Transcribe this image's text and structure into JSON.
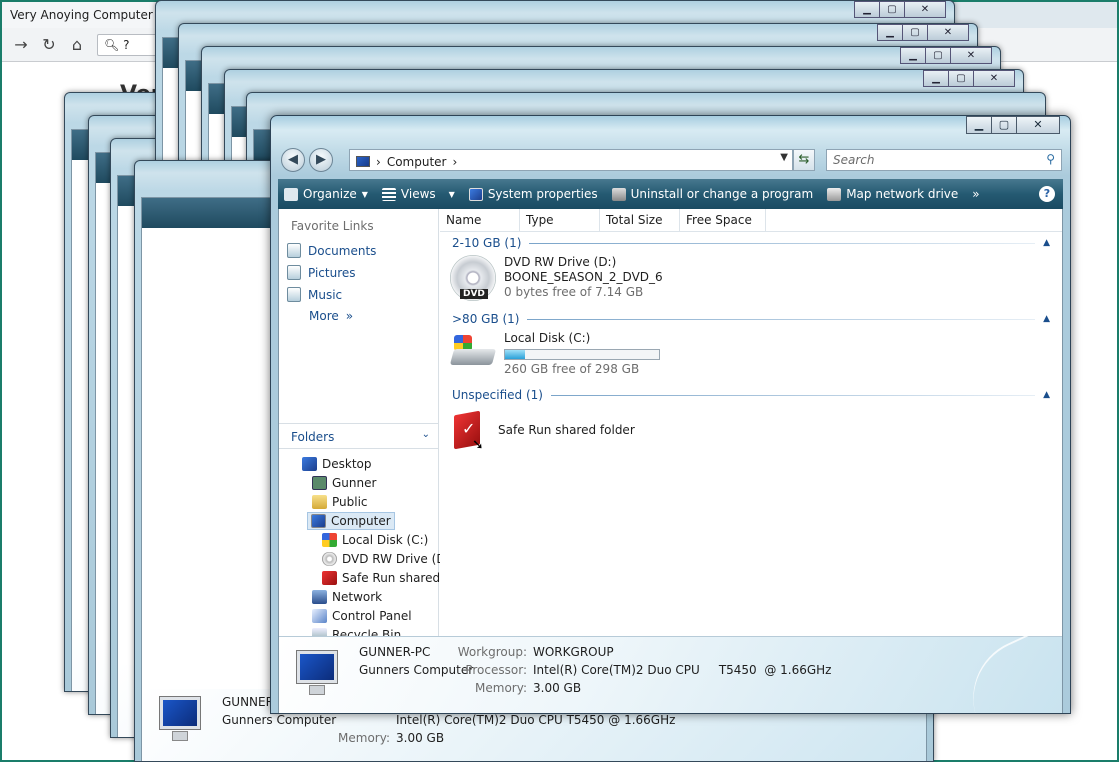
{
  "browser": {
    "tab_title": "Very Anoying Computer P",
    "omnibox": "?",
    "page_heading": "Ver"
  },
  "window": {
    "caption_min": "▁",
    "caption_max": "▢",
    "caption_close": "✕"
  },
  "address": {
    "location": "Computer",
    "search_placeholder": "Search"
  },
  "toolbar": {
    "organize": "Organize",
    "views": "Views",
    "system_properties": "System properties",
    "uninstall": "Uninstall or change a program",
    "map_network": "Map network drive",
    "more": "»",
    "help": "?"
  },
  "sidebar": {
    "favorites_header": "Favorite Links",
    "favorites": [
      "Documents",
      "Pictures",
      "Music"
    ],
    "more": "More",
    "folders_header": "Folders",
    "tree": [
      "Desktop",
      "Gunner",
      "Public",
      "Computer",
      "Local Disk (C:)",
      "DVD RW Drive (D:)",
      "Safe Run shared fo",
      "Network",
      "Control Panel",
      "Recycle Bin"
    ]
  },
  "columns": [
    "Name",
    "Type",
    "Total Size",
    "Free Space"
  ],
  "groups": [
    {
      "label": "2-10 GB (1)"
    },
    {
      "label": ">80 GB (1)"
    },
    {
      "label": "Unspecified (1)"
    }
  ],
  "items": {
    "dvd": {
      "name": "DVD RW Drive (D:)",
      "label": "BOONE_SEASON_2_DVD_6",
      "free": "0 bytes free of 7.14 GB",
      "icon_badge": "DVD"
    },
    "disk": {
      "name": "Local Disk (C:)",
      "free": "260 GB free of 298 GB",
      "used_fraction": 0.13
    },
    "shared": {
      "name": "Safe Run shared folder"
    }
  },
  "details": {
    "pc_name": "GUNNER-PC",
    "pc_desc": "Gunners Computer",
    "workgroup_label": "Workgroup:",
    "workgroup": "WORKGROUP",
    "processor_label": "Processor:",
    "processor": "Intel(R) Core(TM)2 Duo CPU     T5450  @ 1.66GHz",
    "memory_label": "Memory:",
    "memory": "3.00 GB"
  },
  "back_window_details": {
    "pc_name": "GUNNER-PC",
    "pc_desc": "Gunners Computer",
    "processor": "Intel(R) Core(TM)2 Duo CPU     T5450  @ 1.66GHz",
    "memory": "3.00 GB"
  },
  "colors": {
    "desktop": "#1f7a74",
    "command_bar": "#255a72",
    "link": "#1a4e8c"
  }
}
